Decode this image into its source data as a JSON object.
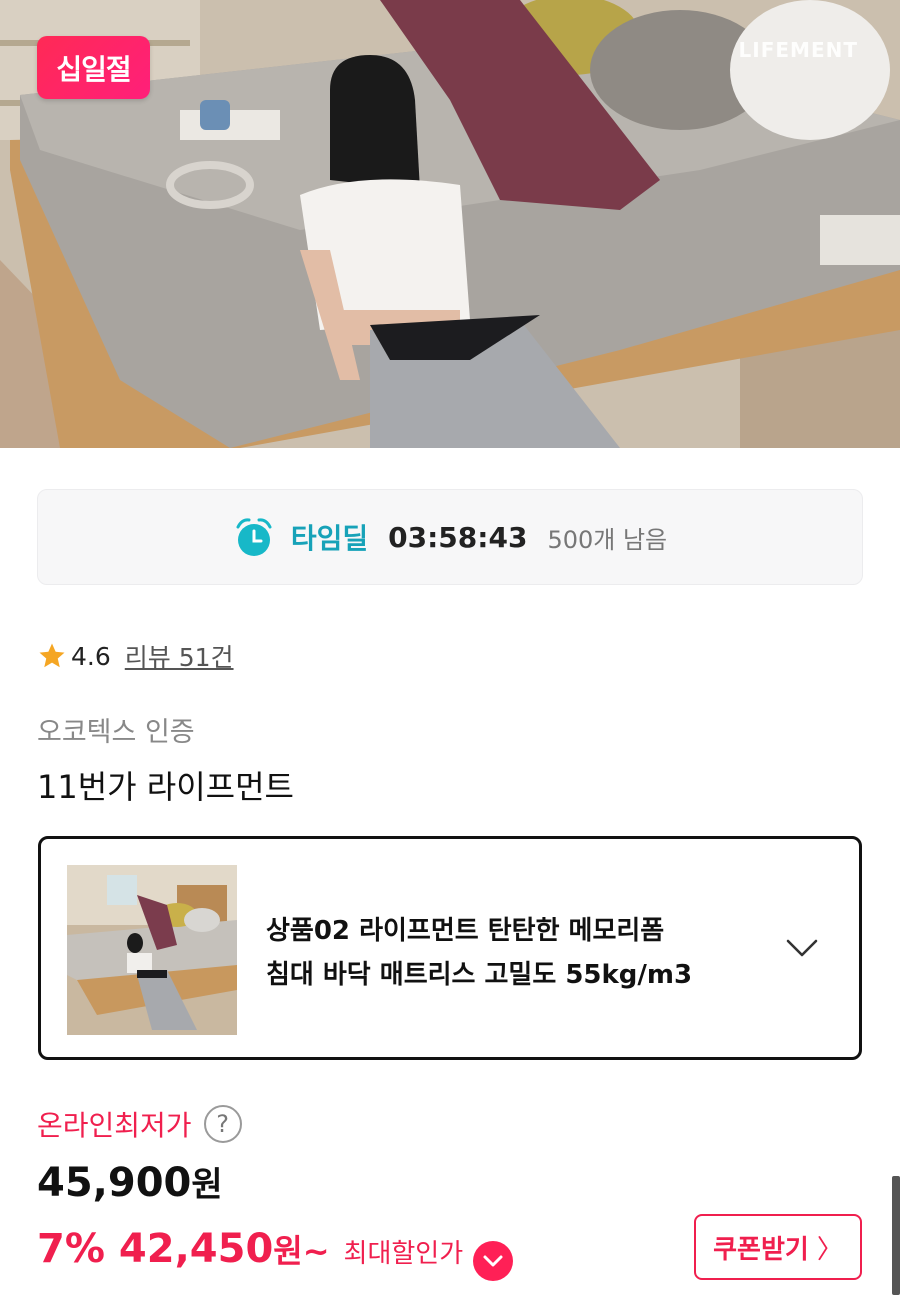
{
  "hero": {
    "badge": "십일절",
    "brand": "LIFEMENT"
  },
  "timedeal": {
    "label": "타임딜",
    "time": "03:58:43",
    "remaining": "500개 남음",
    "accent_color": "#17a2b8"
  },
  "rating": {
    "score": "4.6",
    "reviews": "리뷰 51건"
  },
  "certification": "오코텍스 인증",
  "seller": "11번가 라이프먼트",
  "option": {
    "line1": "상품02 라이프먼트 탄탄한 메모리폼",
    "line2": "침대 바닥 매트리스 고밀도 55kg/m3",
    "icon": "chevron-down-icon"
  },
  "price": {
    "lowest_label": "온라인최저가",
    "help_icon": "?",
    "original_number": "45,900",
    "original_unit": "원",
    "discount": "7%",
    "sale_number": "42,450",
    "sale_unit": "원~",
    "max_label": "최대할인가",
    "accent_color": "#f01f4e"
  },
  "coupon": {
    "label": "쿠폰받기",
    "arrow": "〉"
  }
}
